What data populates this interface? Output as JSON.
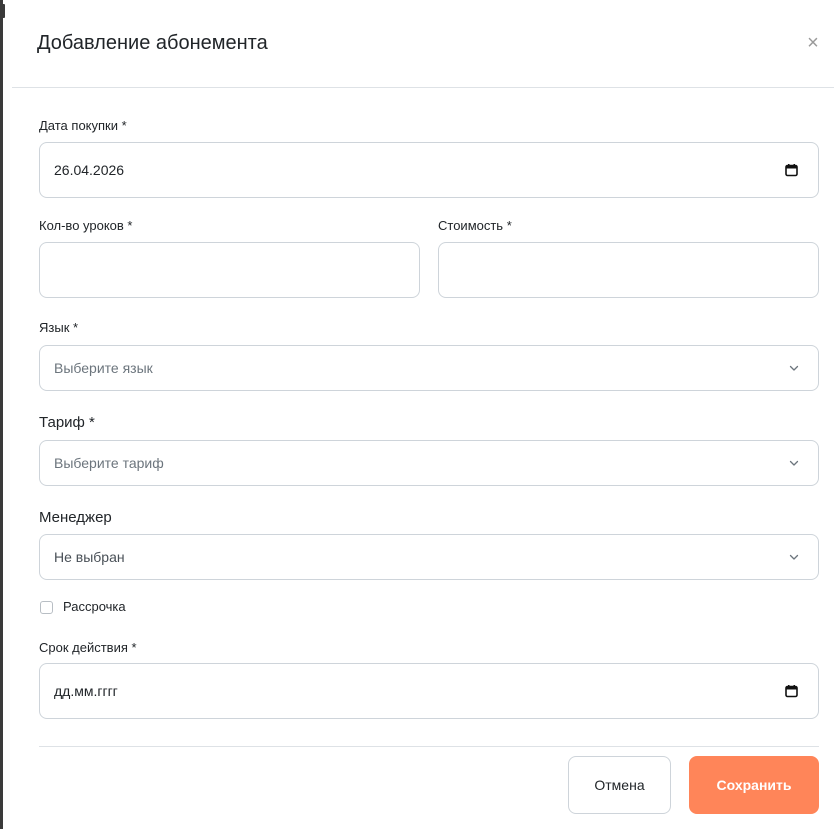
{
  "modal": {
    "title": "Добавление абонемента",
    "close_label": "×"
  },
  "form": {
    "purchase_date": {
      "label": "Дата покупки *",
      "value": "26.04.2026"
    },
    "lessons_count": {
      "label": "Кол-во уроков *",
      "value": ""
    },
    "price": {
      "label": "Стоимость *",
      "value": ""
    },
    "language": {
      "label": "Язык *",
      "placeholder": "Выберите язык"
    },
    "tariff": {
      "label": "Тариф *",
      "placeholder": "Выберите тариф"
    },
    "manager": {
      "label": "Менеджер",
      "value": "Не выбран"
    },
    "installment": {
      "label": "Рассрочка",
      "checked": false
    },
    "expiry_date": {
      "label": "Срок действия *",
      "value": "дд.мм.гггг"
    }
  },
  "footer": {
    "cancel_label": "Отмена",
    "save_label": "Сохранить"
  },
  "colors": {
    "accent": "#ff8559",
    "border": "#ced4da",
    "divider": "#dee2e6"
  },
  "icons": {
    "close": "close-icon",
    "calendar": "calendar-icon",
    "chevron": "chevron-down-icon"
  }
}
